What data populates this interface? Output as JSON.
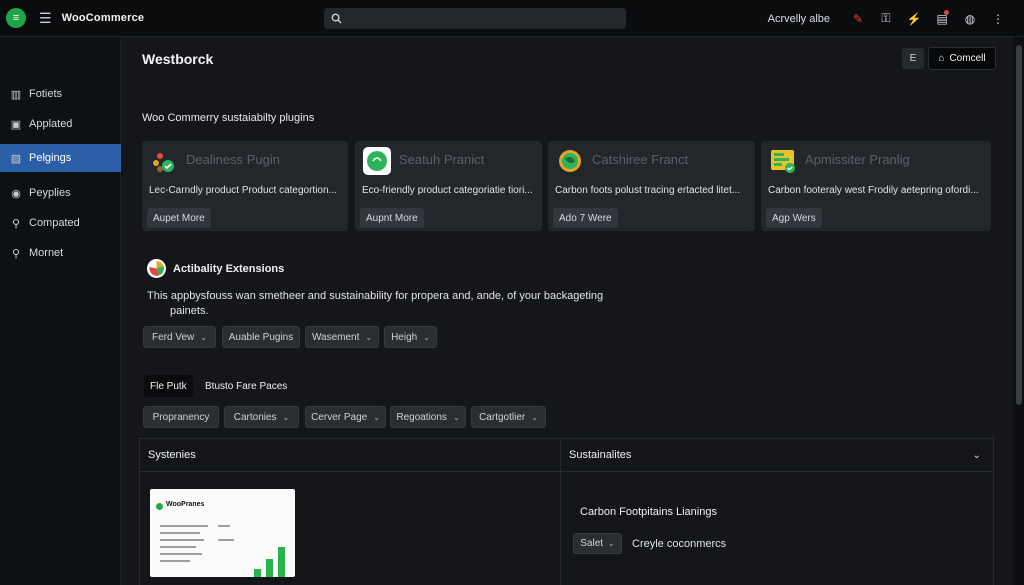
{
  "topbar": {
    "brand": "WooCommerce",
    "search_placeholder": "",
    "status": "Acrvelly albe"
  },
  "sidebar": {
    "items": [
      {
        "label": "Fotiets",
        "icon": "bar-chart-icon"
      },
      {
        "label": "Applated",
        "icon": "document-icon"
      },
      {
        "label": "Pelgings",
        "icon": "plugins-icon",
        "active": true
      },
      {
        "label": "Peyplies",
        "icon": "circle-info-icon"
      },
      {
        "label": "Compated",
        "icon": "pin-icon"
      },
      {
        "label": "Mornet",
        "icon": "search-icon"
      }
    ]
  },
  "header": {
    "title": "Westborck",
    "small_button": "E",
    "cancel_label": "Comcell"
  },
  "plugins_section": {
    "heading": "Woo Commerry sustaiabilty plugins",
    "cards": [
      {
        "title": "Dealiness Pugin",
        "desc": "Lec-Carndly product Product categortion...",
        "button": "Aupet More",
        "icon": "leaf-badge-icon"
      },
      {
        "title": "Seatuh Pranict",
        "desc": "Eco-friendly product categoriatie tiori...",
        "button": "Aupnt More",
        "icon": "chat-bubble-icon"
      },
      {
        "title": "Catshiree Franct",
        "desc": "Carbon foots polust tracing ertacted litet...",
        "button": "Ado 7 Were",
        "icon": "globe-icon"
      },
      {
        "title": "Apmissiter Pranlig",
        "desc": "Carbon footeraly west Frodily aetepring ofordi...",
        "button": "Agp Wers",
        "icon": "chart-badge-icon"
      }
    ]
  },
  "extensions": {
    "title": "Actibality Extensions",
    "desc_line1": "This appbysfouss wan smetheer and sustainability for propera and, ande, of your backageting",
    "desc_line2": "painets.",
    "filters": [
      "Ferd Vew",
      "Auable Pugins",
      "Wasement",
      "Heigh"
    ]
  },
  "tabs": [
    "Fle Putk",
    "Btusto Fare Paces"
  ],
  "filters2": [
    "Propranency",
    "Cartonies",
    "Cerver Page",
    "Regoations",
    "Cartgotlier"
  ],
  "panel_left": {
    "title": "Systenies",
    "thumb_title": "WooPranes"
  },
  "panel_right": {
    "title": "Sustainalites",
    "heading": "Carbon Footpitains  Lianings",
    "select_value": "Salet",
    "label": "Creyle coconmercs"
  },
  "colors": {
    "accent": "#2b5fa8",
    "brand_green": "#1fa64a",
    "alert_red": "#e0454b"
  }
}
